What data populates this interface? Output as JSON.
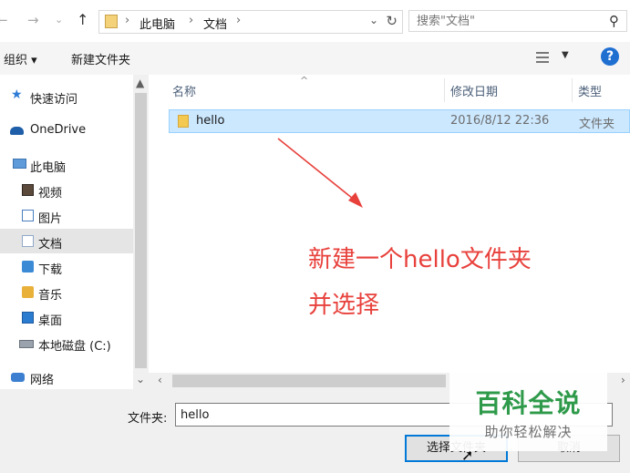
{
  "address": {
    "crumbs": [
      "此电脑",
      "文档"
    ],
    "separator": "›"
  },
  "search": {
    "placeholder": "搜索\"文档\""
  },
  "toolbar": {
    "organize_label": "组织 ▾",
    "new_folder_label": "新建文件夹",
    "help_label": "?"
  },
  "sidebar": {
    "items": [
      {
        "label": "快速访问",
        "icon": "star-icon"
      },
      {
        "label": "OneDrive",
        "icon": "cloud-icon"
      },
      {
        "label": "此电脑",
        "icon": "computer-icon"
      },
      {
        "label": "视频",
        "icon": "video-icon"
      },
      {
        "label": "图片",
        "icon": "picture-icon"
      },
      {
        "label": "文档",
        "icon": "document-icon",
        "selected": true
      },
      {
        "label": "下载",
        "icon": "download-icon"
      },
      {
        "label": "音乐",
        "icon": "music-icon"
      },
      {
        "label": "桌面",
        "icon": "desktop-icon"
      },
      {
        "label": "本地磁盘 (C:)",
        "icon": "drive-icon"
      },
      {
        "label": "网络",
        "icon": "network-icon"
      }
    ]
  },
  "columns": {
    "name": "名称",
    "date": "修改日期",
    "type": "类型"
  },
  "files": [
    {
      "name": "hello",
      "date": "2016/8/12 22:36",
      "type": "文件夹"
    }
  ],
  "annotation": {
    "line1": "新建一个hello文件夹",
    "line2": "并选择",
    "color": "#e8413c"
  },
  "footer": {
    "folder_label": "文件夹:",
    "folder_value": "hello",
    "select_button": "选择文件夹",
    "cancel_button": "取消"
  },
  "watermark": {
    "title": "百科全说",
    "subtitle": "助你轻松解决"
  }
}
